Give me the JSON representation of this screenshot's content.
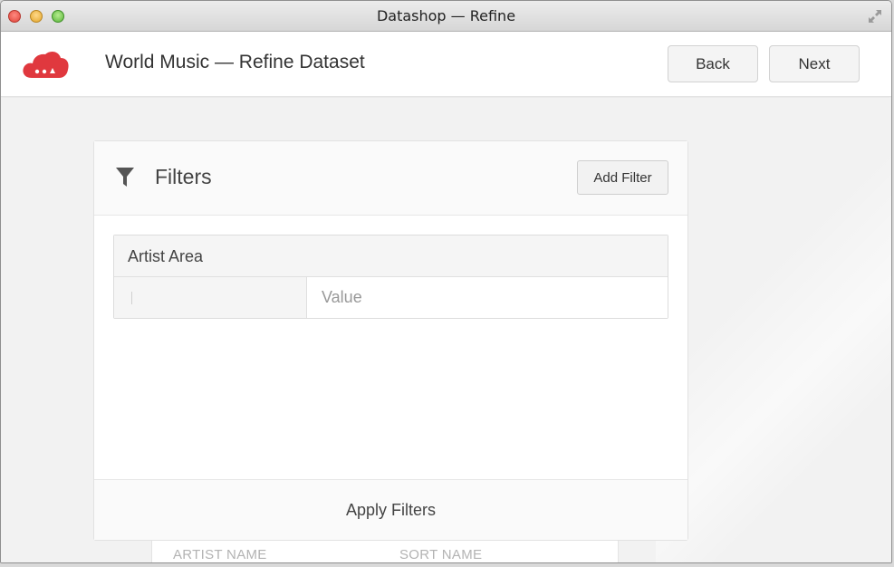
{
  "window": {
    "title": "Datashop — Refine"
  },
  "header": {
    "title": "World Music — Refine Dataset",
    "back_label": "Back",
    "next_label": "Next",
    "logo_color": "#e0383e"
  },
  "filters": {
    "title": "Filters",
    "add_filter_label": "Add Filter",
    "items": [
      {
        "field": "Artist Area",
        "value": "",
        "value_placeholder": "Value"
      }
    ],
    "apply_label": "Apply Filters"
  },
  "table_preview": {
    "columns": [
      "ARTIST NAME",
      "SORT NAME"
    ]
  }
}
